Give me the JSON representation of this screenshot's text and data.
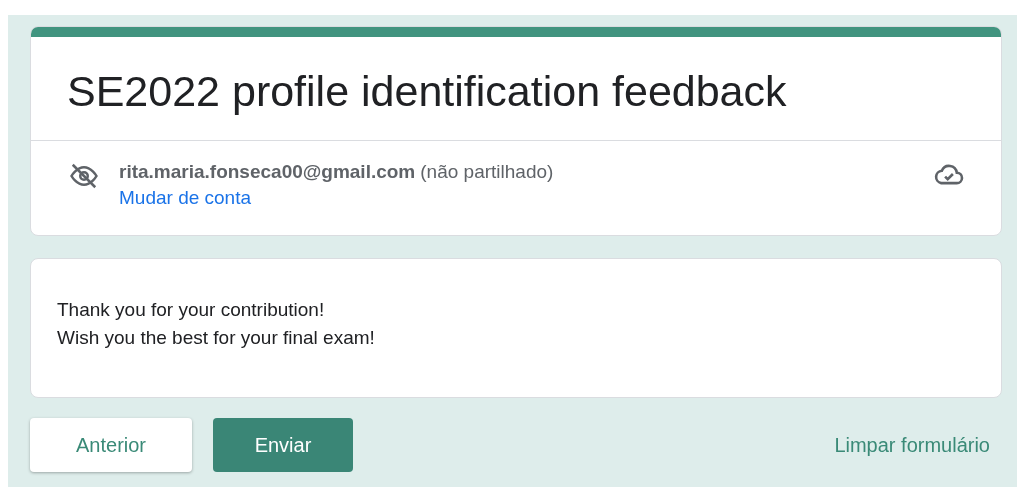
{
  "form": {
    "title": "SE2022 profile identification feedback"
  },
  "account": {
    "email": "rita.maria.fonseca00@gmail.com",
    "note": "(não partilhado)",
    "switch_link": "Mudar de conta"
  },
  "message": {
    "lines": [
      "Thank you for your contribution!",
      "Wish you the best for your final exam!"
    ]
  },
  "buttons": {
    "back": "Anterior",
    "submit": "Enviar",
    "clear": "Limpar formulário"
  }
}
